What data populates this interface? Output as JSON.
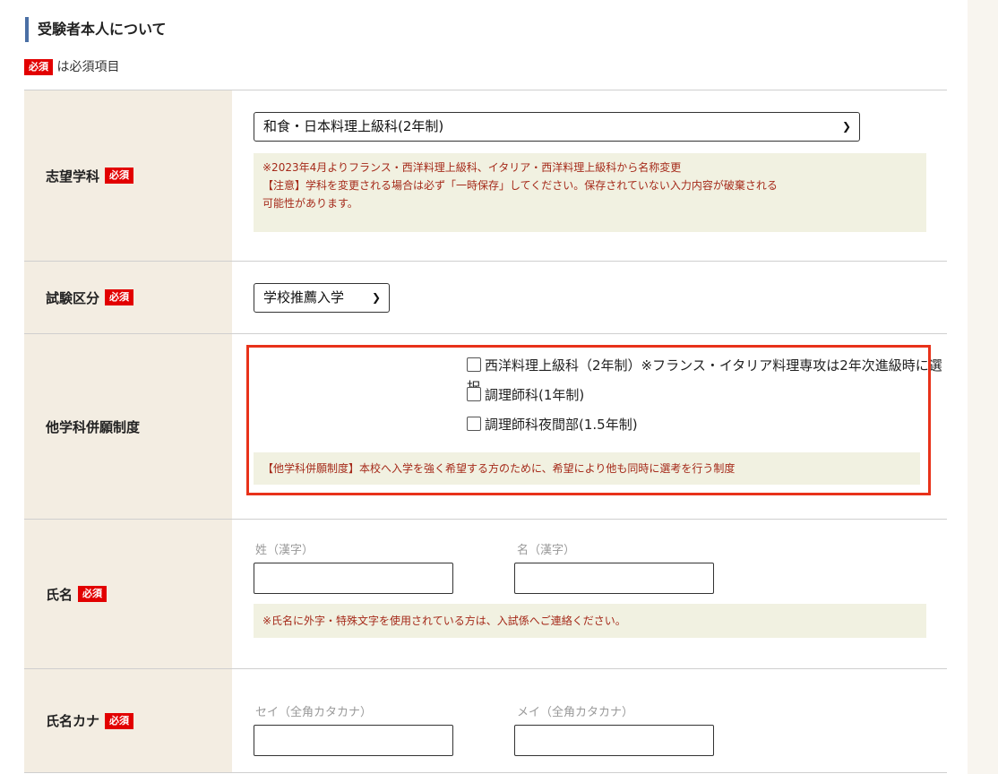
{
  "section_title": "受験者本人について",
  "required_badge": "必須",
  "required_note": "は必須項目",
  "rows": {
    "department": {
      "label": "志望学科",
      "selected": "和食・日本料理上級科(2年制)",
      "note_line1": "※2023年4月よりフランス・西洋料理上級科、イタリア・西洋料理上級科から名称変更",
      "note_line2": "【注意】学科を変更される場合は必ず「一時保存」してください。保存されていない入力内容が破棄される",
      "note_line3": "可能性があります。"
    },
    "exam_type": {
      "label": "試験区分",
      "selected": "学校推薦入学"
    },
    "combined": {
      "label": "他学科併願制度",
      "options": [
        "西洋料理上級科（2年制）※フランス・イタリア料理専攻は2年次進級時に選択",
        "調理師科(1年制)",
        "調理師科夜間部(1.5年制)"
      ],
      "note": "【他学科併願制度】本校へ入学を強く希望する方のために、希望により他も同時に選考を行う制度"
    },
    "name": {
      "label": "氏名",
      "last_label": "姓（漢字）",
      "first_label": "名（漢字）",
      "note": "※氏名に外字・特殊文字を使用されている方は、入試係へご連絡ください。"
    },
    "name_kana": {
      "label": "氏名カナ",
      "last_label": "セイ（全角カタカナ）",
      "first_label": "メイ（全角カタカナ）"
    }
  }
}
